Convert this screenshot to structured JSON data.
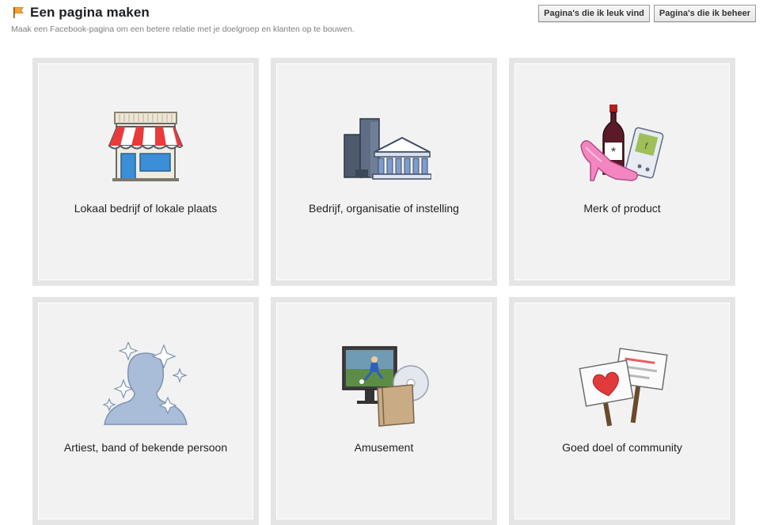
{
  "header": {
    "title": "Een pagina maken",
    "subtitle": "Maak een Facebook-pagina om een betere relatie met je doelgroep en klanten op te bouwen.",
    "buttons": [
      "Pagina's die ik leuk vind",
      "Pagina's die ik beheer"
    ]
  },
  "categories": [
    {
      "label": "Lokaal bedrijf of lokale plaats",
      "icon": "storefront-icon"
    },
    {
      "label": "Bedrijf, organisatie of instelling",
      "icon": "buildings-icon"
    },
    {
      "label": "Merk of product",
      "icon": "products-icon"
    },
    {
      "label": "Artiest, band of bekende persoon",
      "icon": "celebrity-icon"
    },
    {
      "label": "Amusement",
      "icon": "entertainment-icon"
    },
    {
      "label": "Goed doel of community",
      "icon": "cause-signs-icon"
    }
  ]
}
